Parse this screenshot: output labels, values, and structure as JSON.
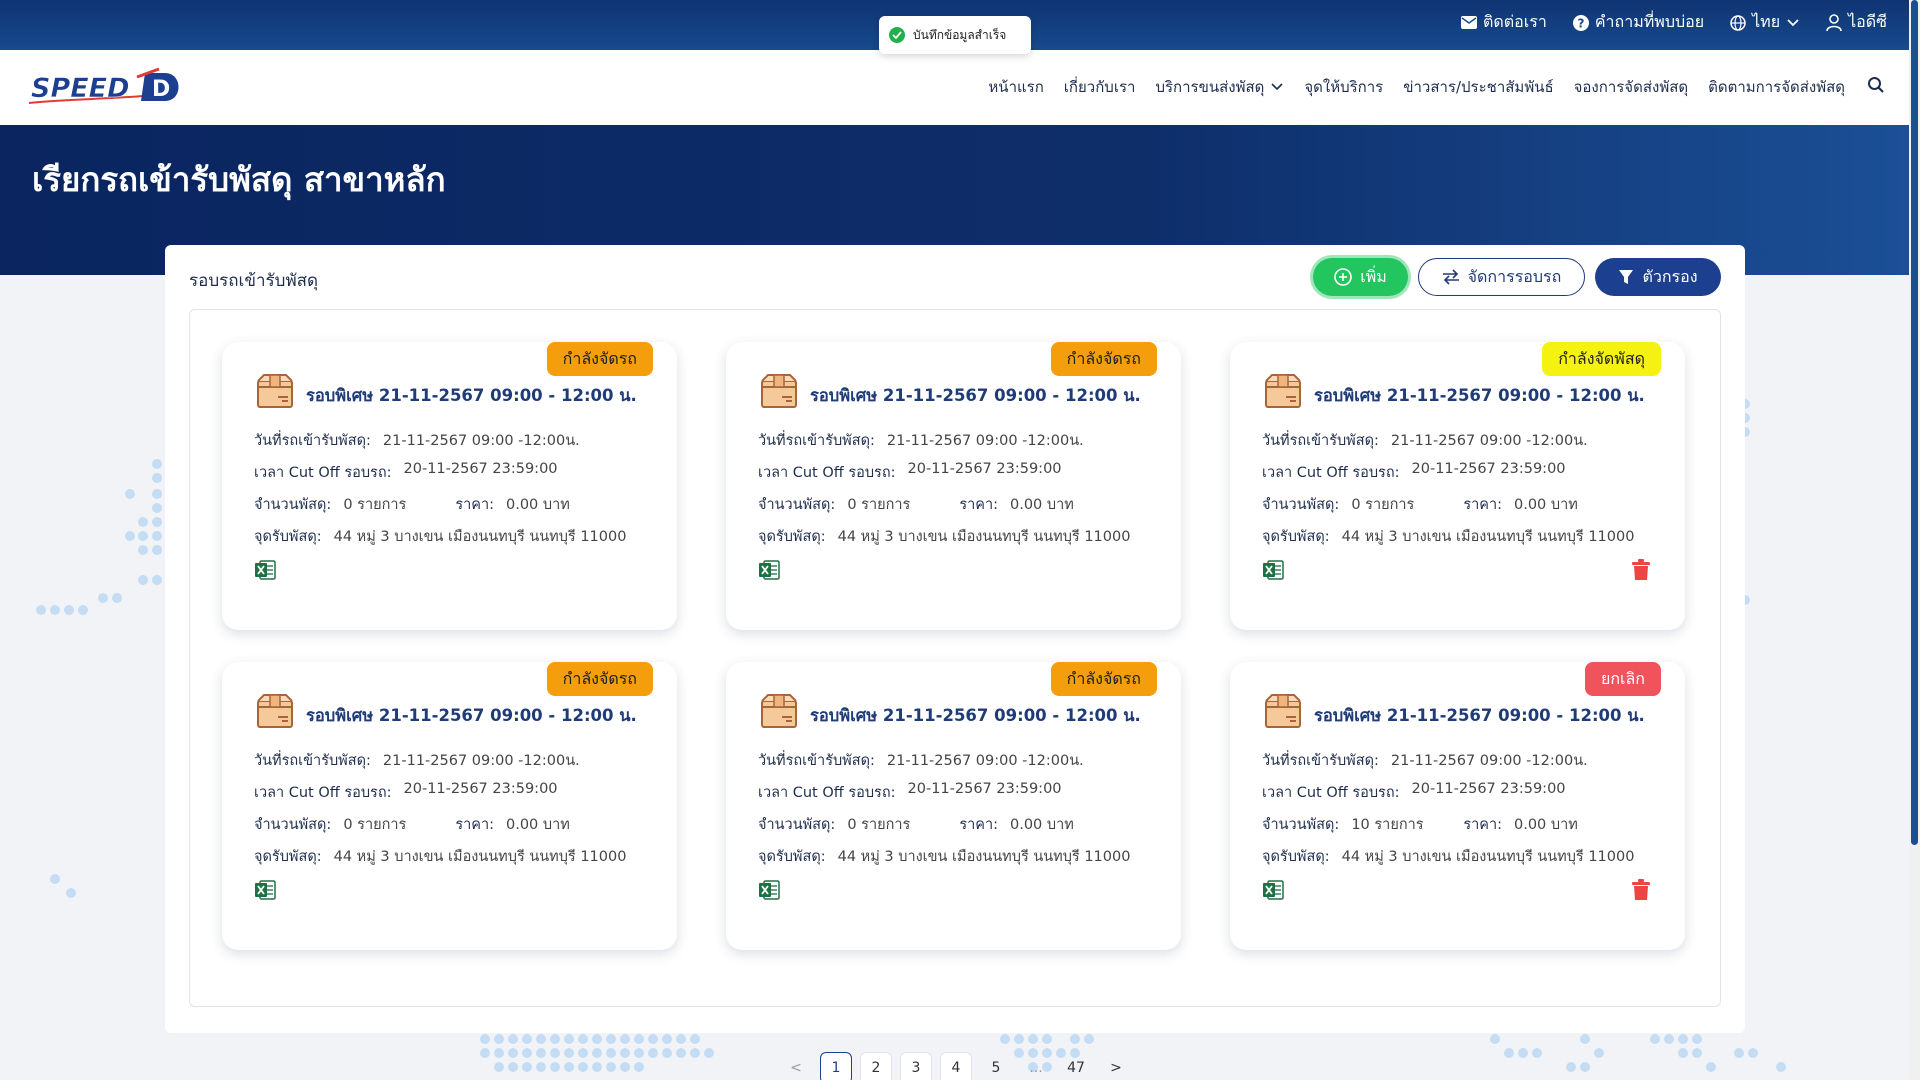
{
  "topbar": {
    "contact": "ติดต่อเรา",
    "faq": "คำถามที่พบบ่อย",
    "language": "ไทย",
    "user": "ไอดีซี"
  },
  "toast": {
    "message": "บันทึกข้อมูลสำเร็จ"
  },
  "logo": {
    "text": "SPEED",
    "letter": "D"
  },
  "nav": {
    "items": [
      "หน้าแรก",
      "เกี่ยวกับเรา",
      "บริการขนส่งพัสดุ",
      "จุดให้บริการ",
      "ข่าวสาร/ประชาสัมพันธ์",
      "จองการจัดส่งพัสดุ",
      "ติดตามการจัดส่งพัสดุ"
    ]
  },
  "hero": {
    "title": "เรียกรถเข้ารับพัสดุ สาขาหลัก"
  },
  "panel": {
    "title": "รอบรถเข้ารับพัสดุ",
    "add_label": "เพิ่ม",
    "manage_label": "จัดการรอบรถ",
    "filter_label": "ตัวกรอง"
  },
  "labels": {
    "pickup_date": "วันที่รถเข้ารับพัสดุ:",
    "cutoff": "เวลา Cut Off รอบรถ:",
    "count": "จำนวนพัสดุ:",
    "price": "ราคา:",
    "location": "จุดรับพัสดุ:"
  },
  "cards": [
    {
      "status": "กำลังจัดรถ",
      "status_color": "#f59e0b",
      "title": "รอบพิเศษ 21-11-2567 09:00 - 12:00 น.",
      "pickup_date": "21-11-2567 09:00 -12:00น.",
      "cutoff": "20-11-2567 23:59:00",
      "count": "0 รายการ",
      "price": "0.00 บาท",
      "location": "44 หมู่ 3 บางเขน เมืองนนทบุรี นนทบุรี 11000",
      "can_delete": false
    },
    {
      "status": "กำลังจัดรถ",
      "status_color": "#f59e0b",
      "title": "รอบพิเศษ 21-11-2567 09:00 - 12:00 น.",
      "pickup_date": "21-11-2567 09:00 -12:00น.",
      "cutoff": "20-11-2567 23:59:00",
      "count": "0 รายการ",
      "price": "0.00 บาท",
      "location": "44 หมู่ 3 บางเขน เมืองนนทบุรี นนทบุรี 11000",
      "can_delete": false
    },
    {
      "status": "กำลังจัดพัสดุ",
      "status_color": "#f5f111",
      "title": "รอบพิเศษ 21-11-2567 09:00 - 12:00 น.",
      "pickup_date": "21-11-2567 09:00 -12:00น.",
      "cutoff": "20-11-2567 23:59:00",
      "count": "0 รายการ",
      "price": "0.00 บาท",
      "location": "44 หมู่ 3 บางเขน เมืองนนทบุรี นนทบุรี 11000",
      "can_delete": true
    },
    {
      "status": "กำลังจัดรถ",
      "status_color": "#f59e0b",
      "title": "รอบพิเศษ 21-11-2567 09:00 - 12:00 น.",
      "pickup_date": "21-11-2567 09:00 -12:00น.",
      "cutoff": "20-11-2567 23:59:00",
      "count": "0 รายการ",
      "price": "0.00 บาท",
      "location": "44 หมู่ 3 บางเขน เมืองนนทบุรี นนทบุรี 11000",
      "can_delete": false
    },
    {
      "status": "กำลังจัดรถ",
      "status_color": "#f59e0b",
      "title": "รอบพิเศษ 21-11-2567 09:00 - 12:00 น.",
      "pickup_date": "21-11-2567 09:00 -12:00น.",
      "cutoff": "20-11-2567 23:59:00",
      "count": "0 รายการ",
      "price": "0.00 บาท",
      "location": "44 หมู่ 3 บางเขน เมืองนนทบุรี นนทบุรี 11000",
      "can_delete": false
    },
    {
      "status": "ยกเลิก",
      "status_color": "#f1535d",
      "title": "รอบพิเศษ 21-11-2567 09:00 - 12:00 น.",
      "pickup_date": "21-11-2567 09:00 -12:00น.",
      "cutoff": "20-11-2567 23:59:00",
      "count": "10 รายการ",
      "price": "0.00 บาท",
      "location": "44 หมู่ 3 บางเขน เมืองนนทบุรี นนทบุรี 11000",
      "can_delete": true
    }
  ],
  "pagination": {
    "prev": "<",
    "pages": [
      "1",
      "2",
      "3",
      "4",
      "5",
      "...",
      "47"
    ],
    "current": "1",
    "next": ">"
  }
}
